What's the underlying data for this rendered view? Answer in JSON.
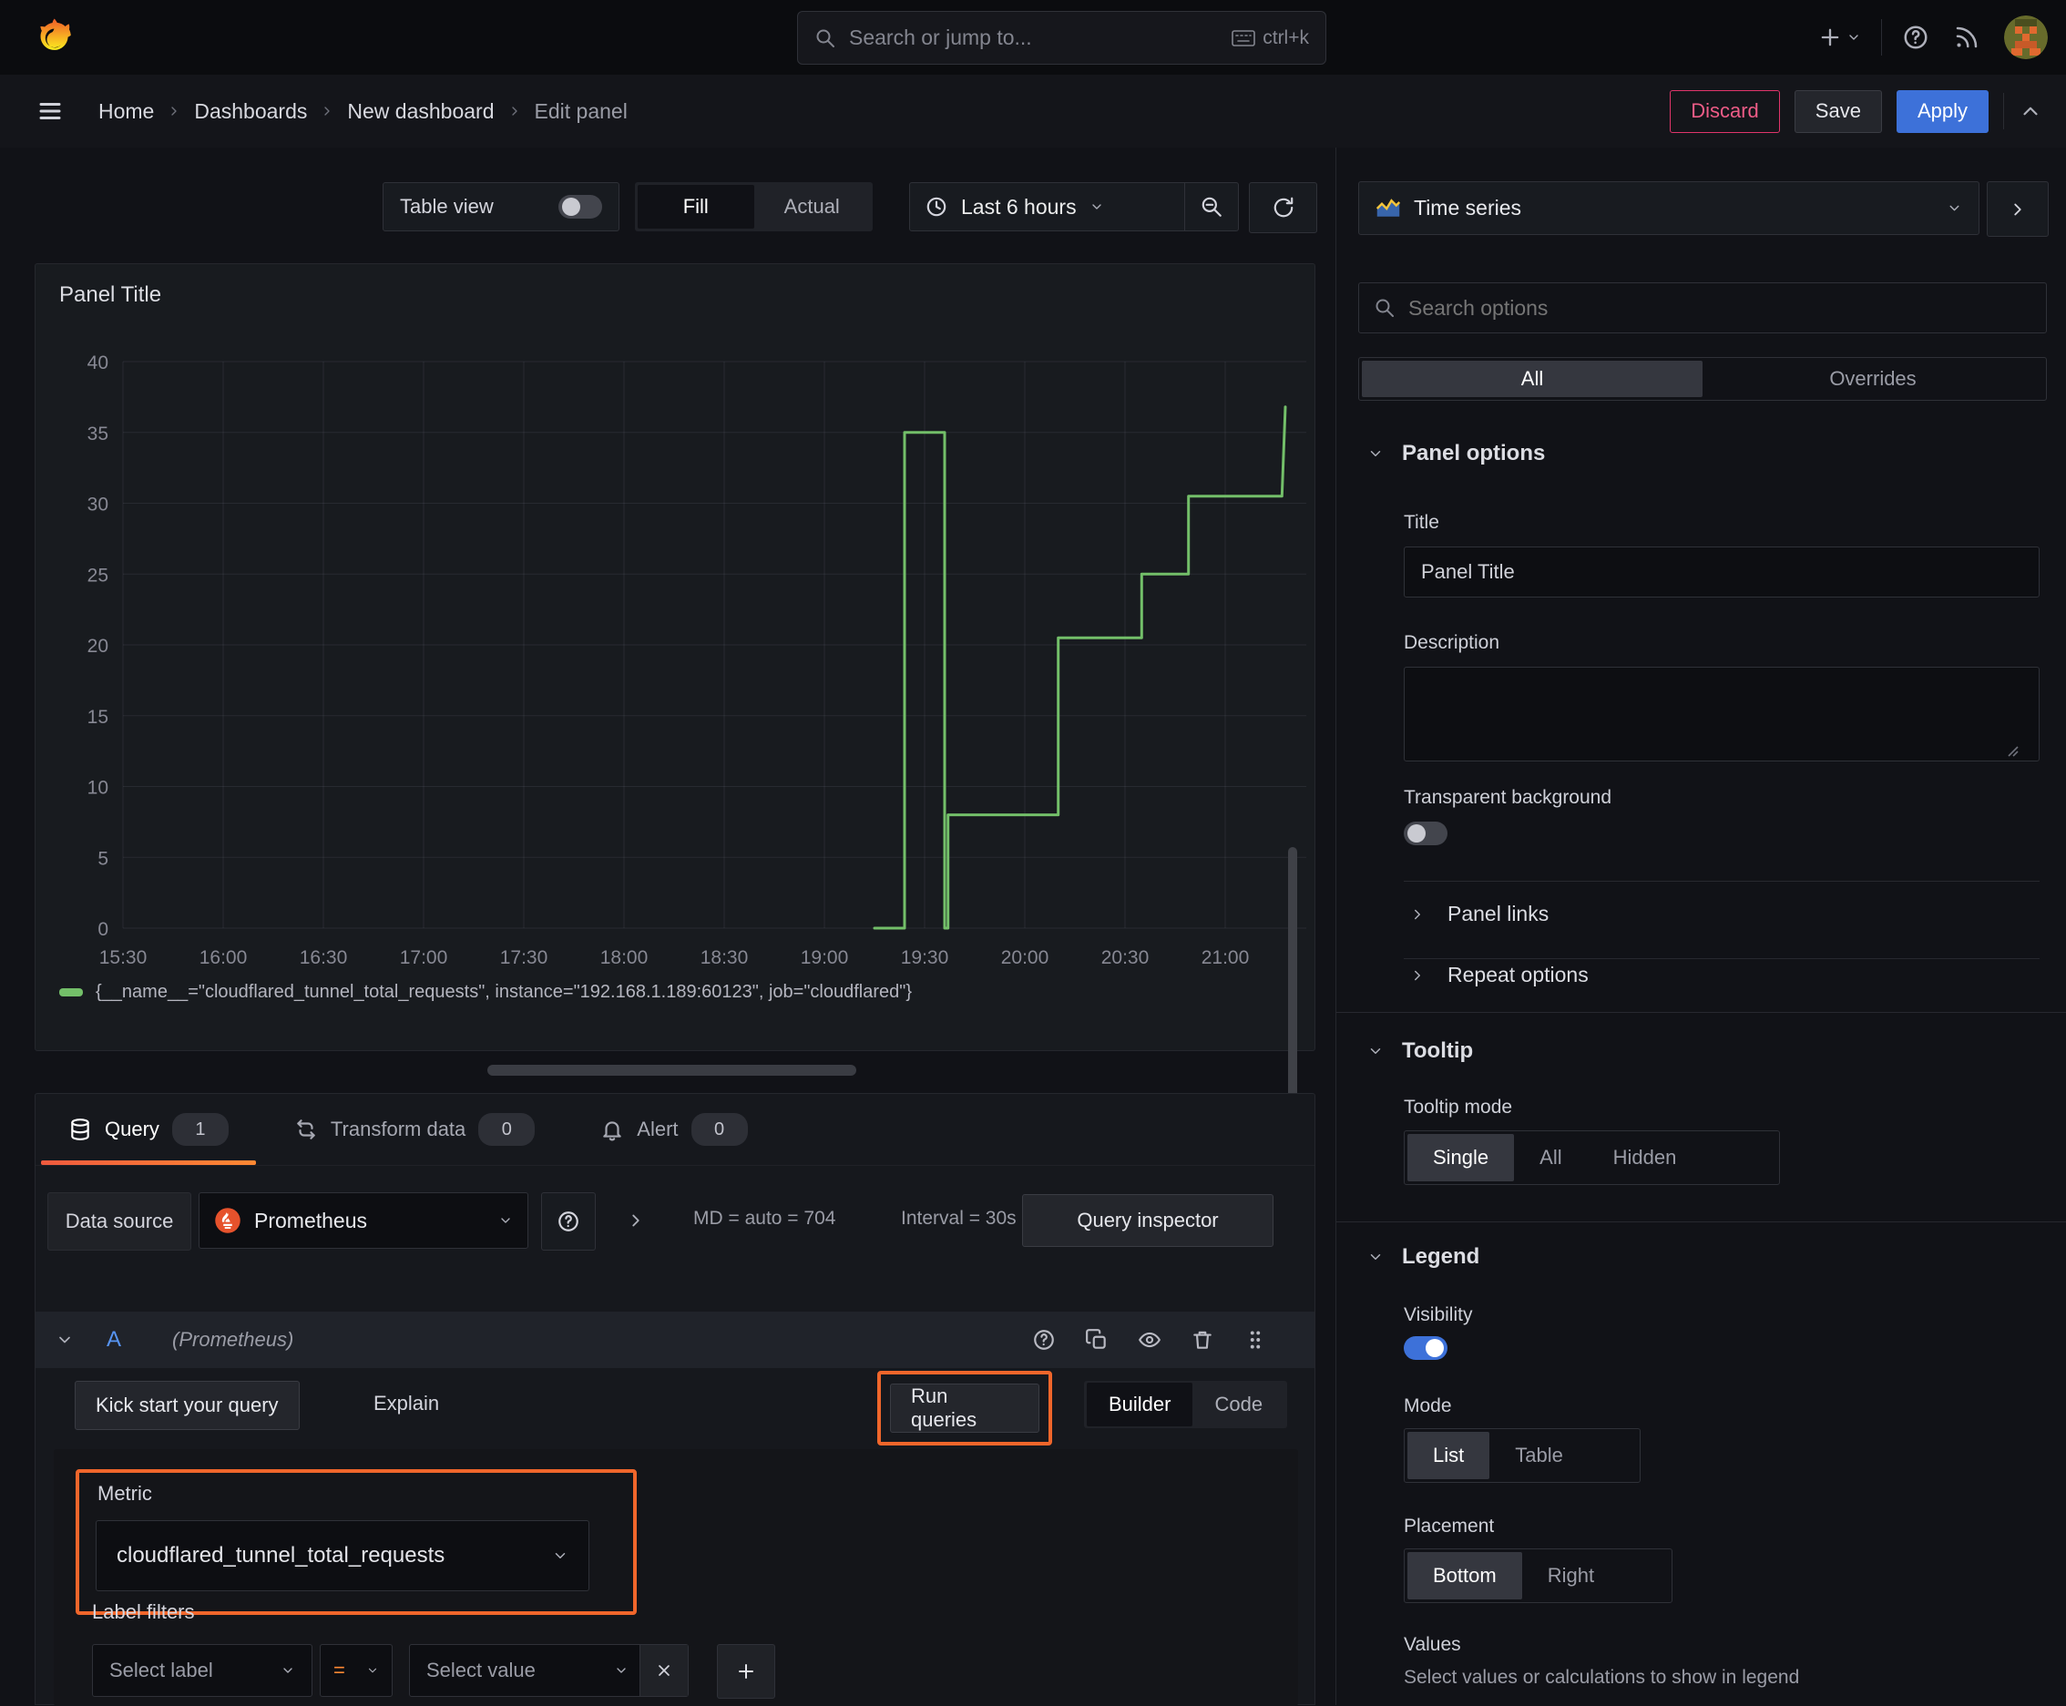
{
  "topbar": {
    "search_placeholder": "Search or jump to...",
    "shortcut": "ctrl+k"
  },
  "breadcrumb": {
    "items": [
      "Home",
      "Dashboards",
      "New dashboard",
      "Edit panel"
    ]
  },
  "actions": {
    "discard": "Discard",
    "save": "Save",
    "apply": "Apply"
  },
  "toolbar": {
    "table_view": "Table view",
    "fill": "Fill",
    "actual": "Actual",
    "time_range": "Last 6 hours"
  },
  "panel": {
    "title": "Panel Title"
  },
  "chart_data": {
    "type": "line",
    "title": "Panel Title",
    "x_ticks": [
      "15:30",
      "16:00",
      "16:30",
      "17:00",
      "17:30",
      "18:00",
      "18:30",
      "19:00",
      "19:30",
      "20:00",
      "20:30",
      "21:00"
    ],
    "y_ticks": [
      0,
      5,
      10,
      15,
      20,
      25,
      30,
      35,
      40
    ],
    "ylim": [
      0,
      40
    ],
    "xlabel": "",
    "ylabel": "",
    "grid": true,
    "legend_position": "bottom",
    "series": [
      {
        "name": "{__name__=\"cloudflared_tunnel_total_requests\", instance=\"192.168.1.189:60123\", job=\"cloudflared\"}",
        "color": "#73BF69",
        "points": [
          [
            "19:15",
            0
          ],
          [
            "19:24",
            0
          ],
          [
            "19:24",
            35
          ],
          [
            "19:36",
            35
          ],
          [
            "19:36",
            0
          ],
          [
            "19:37",
            0
          ],
          [
            "19:37",
            8
          ],
          [
            "20:10",
            8
          ],
          [
            "20:10",
            20.5
          ],
          [
            "20:35",
            20.5
          ],
          [
            "20:35",
            25
          ],
          [
            "20:49",
            25
          ],
          [
            "20:49",
            30.5
          ],
          [
            "21:17",
            30.5
          ],
          [
            "21:18",
            36.8
          ]
        ]
      }
    ]
  },
  "tabs": {
    "query": "Query",
    "query_count": "1",
    "transform": "Transform data",
    "transform_count": "0",
    "alert": "Alert",
    "alert_count": "0"
  },
  "query": {
    "datasource_label": "Data source",
    "datasource": "Prometheus",
    "stats_md": "MD = auto = 704",
    "stats_interval": "Interval = 30s",
    "inspector": "Query inspector",
    "row_id": "A",
    "row_ds": "(Prometheus)",
    "kick_start": "Kick start your query",
    "explain": "Explain",
    "run_queries": "Run queries",
    "builder": "Builder",
    "code": "Code",
    "metric_label": "Metric",
    "metric_value": "cloudflared_tunnel_total_requests",
    "label_filters": "Label filters",
    "select_label": "Select label",
    "operator": "=",
    "select_value": "Select value"
  },
  "sidebar": {
    "visualization": "Time series",
    "search_placeholder": "Search options",
    "tab_all": "All",
    "tab_overrides": "Overrides",
    "panel_options": {
      "heading": "Panel options",
      "title_label": "Title",
      "title_value": "Panel Title",
      "description_label": "Description",
      "transparent": "Transparent background"
    },
    "collapsed": {
      "panel_links": "Panel links",
      "repeat_options": "Repeat options"
    },
    "tooltip": {
      "heading": "Tooltip",
      "mode_label": "Tooltip mode",
      "options": [
        "Single",
        "All",
        "Hidden"
      ]
    },
    "legend": {
      "heading": "Legend",
      "visibility": "Visibility",
      "mode_label": "Mode",
      "mode_options": [
        "List",
        "Table"
      ],
      "placement_label": "Placement",
      "placement_options": [
        "Bottom",
        "Right"
      ],
      "values_label": "Values",
      "values_hint": "Select values or calculations to show in legend"
    }
  },
  "colors": {
    "accent_orange": "#FF8833",
    "annotation_highlight": "#F0662B",
    "series_green": "#73BF69",
    "primary_blue": "#3D71D9",
    "destructive_pink": "#E0356B",
    "prometheus_orange": "#E6522C"
  }
}
